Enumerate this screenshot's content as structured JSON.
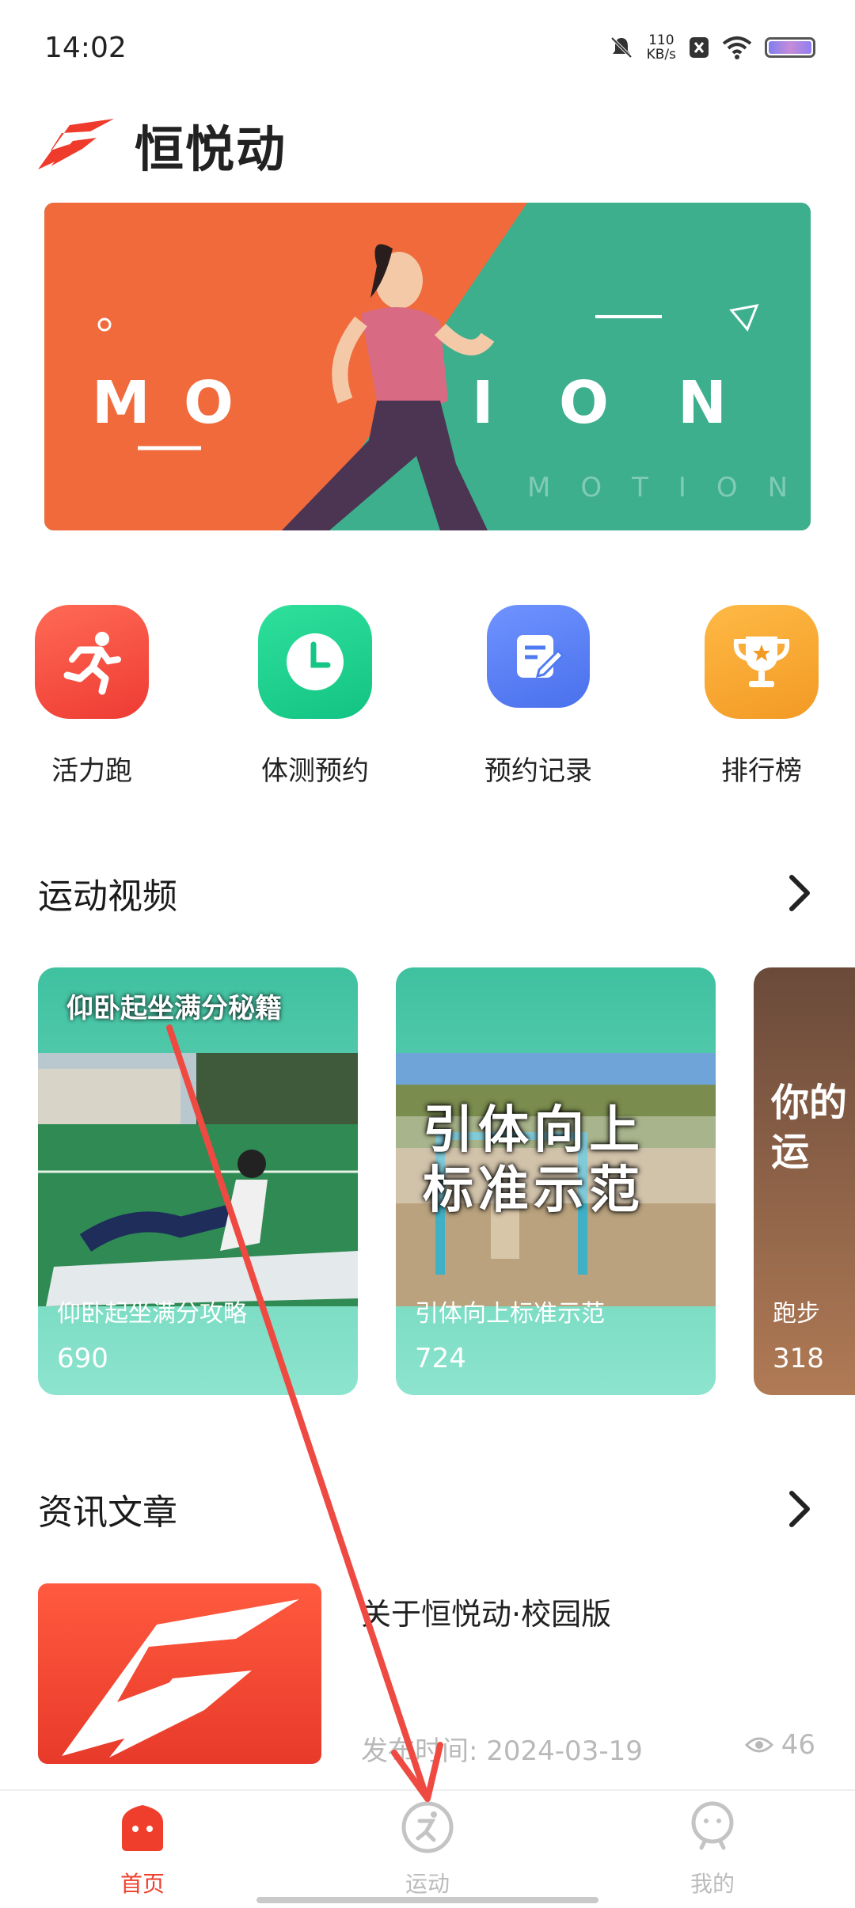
{
  "status_bar": {
    "time": "14:02",
    "net_speed_value": "110",
    "net_speed_unit": "KB/s",
    "icons": [
      "mute-icon",
      "close-box-icon",
      "wifi-icon",
      "battery-icon"
    ]
  },
  "header": {
    "app_name": "恒悦动",
    "logo_icon": "hengyuedong-logo-icon"
  },
  "banner": {
    "letters": [
      "M",
      "O",
      "I",
      "O",
      "N"
    ],
    "subtext": "MOTION",
    "colors": {
      "left": "#f06a3c",
      "right": "#3daf8c"
    }
  },
  "actions": [
    {
      "label": "活力跑",
      "icon": "running-icon",
      "color": "#f2413b"
    },
    {
      "label": "体测预约",
      "icon": "clock-icon",
      "color": "#1dd08d"
    },
    {
      "label": "预约记录",
      "icon": "edit-note-icon",
      "color": "#4e7bf1"
    },
    {
      "label": "排行榜",
      "icon": "trophy-icon",
      "color": "#f3a531"
    }
  ],
  "videos_section": {
    "title": "运动视频",
    "items": [
      {
        "overlay": "仰卧起坐满分秘籍",
        "caption": "仰卧起坐满分攻略",
        "views": "690"
      },
      {
        "overlay": "引体向上标准示范",
        "caption": "引体向上标准示范",
        "views": "724"
      },
      {
        "overlay": "你的运",
        "caption": "跑步",
        "views": "318"
      }
    ]
  },
  "articles_section": {
    "title": "资讯文章",
    "items": [
      {
        "title": "关于恒悦动·校园版",
        "date": "发布时间: 2024-03-19",
        "views": "46"
      }
    ]
  },
  "tabbar": {
    "tabs": [
      {
        "label": "首页",
        "icon": "home-icon",
        "active": true
      },
      {
        "label": "运动",
        "icon": "sport-icon",
        "active": false
      },
      {
        "label": "我的",
        "icon": "profile-icon",
        "active": false
      }
    ],
    "active_color": "#ef3e2c",
    "inactive_color": "#bcbcbc"
  }
}
